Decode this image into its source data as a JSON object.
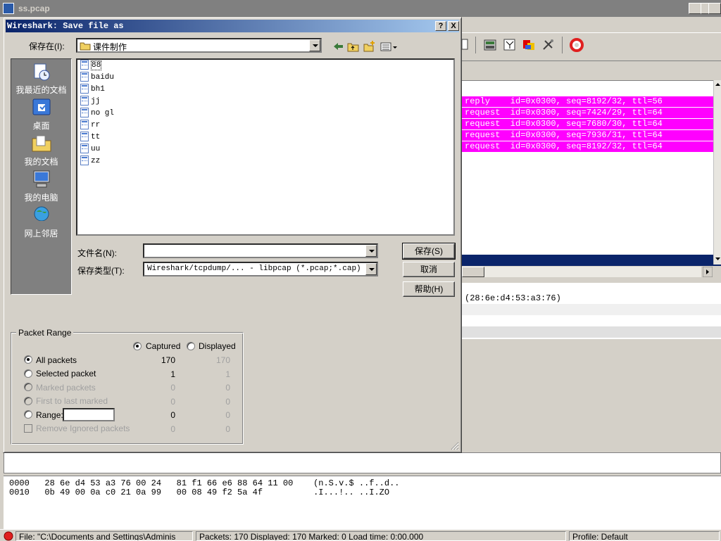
{
  "main_window": {
    "title": "ss.pcap",
    "caption_buttons": [
      "_",
      "□",
      "X"
    ]
  },
  "packet_list": {
    "rows": [
      "reply    id=0x0300, seq=8192/32, ttl=56",
      "request  id=0x0300, seq=7424/29, ttl=64",
      "request  id=0x0300, seq=7680/30, ttl=64",
      "request  id=0x0300, seq=7936/31, ttl=64",
      "request  id=0x0300, seq=8192/32, ttl=64"
    ],
    "highlight_color": "#ff00ff",
    "selection_color": "#0a246a"
  },
  "details": {
    "row": "(28:6e:d4:53:a3:76)"
  },
  "bytes": {
    "lines": [
      "0000   28 6e d4 53 a3 76 00 24   81 f1 66 e6 88 64 11 00    (n.S.v.$ ..f..d..",
      "0010   0b 49 00 0a c0 21 0a 99   00 08 49 f2 5a 4f          .I...!.. ..I.ZO"
    ]
  },
  "status": {
    "file": "File: \"C:\\Documents and Settings\\Adminis",
    "packets": "Packets: 170 Displayed: 170 Marked: 0 Load time: 0:00.000",
    "profile": "Profile: Default"
  },
  "dialog": {
    "title": "Wireshark: Save file as",
    "help_btn": "?",
    "close_btn": "X",
    "save_in_label": "保存在(I):",
    "save_in_value": "课件制作",
    "places": [
      "我最近的文档",
      "桌面",
      "我的文档",
      "我的电脑",
      "网上邻居"
    ],
    "files": [
      "88",
      "baidu",
      "bh1",
      "jj",
      "no gl",
      "rr",
      "tt",
      "uu",
      "zz"
    ],
    "filename_label": "文件名(N):",
    "filename_value": "",
    "filetype_label": "保存类型(T):",
    "filetype_value": "Wireshark/tcpdump/... - libpcap (*.pcap;*.cap)",
    "save_button": "保存(S)",
    "cancel_button": "取消",
    "help_button": "帮助(H)",
    "packet_range": {
      "legend": "Packet Range",
      "captured": "Captured",
      "displayed": "Displayed",
      "rows": [
        {
          "label": "All packets",
          "captured": "170",
          "displayed": "170"
        },
        {
          "label": "Selected packet",
          "captured": "1",
          "displayed": "1"
        },
        {
          "label": "Marked packets",
          "captured": "0",
          "displayed": "0"
        },
        {
          "label": "First to last marked",
          "captured": "0",
          "displayed": "0"
        },
        {
          "label": "Range:",
          "captured": "0",
          "displayed": "0"
        },
        {
          "label": "Remove Ignored packets",
          "captured": "0",
          "displayed": "0"
        }
      ]
    }
  }
}
